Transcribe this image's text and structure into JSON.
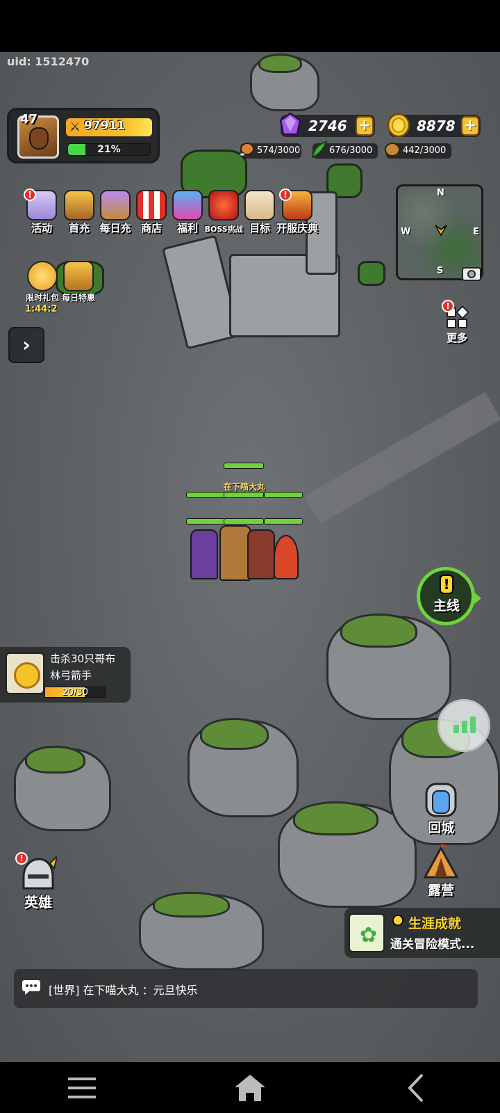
{
  "uid": "uid: 1512470",
  "player": {
    "level": "47",
    "power": "97911",
    "exp_percent": "21%",
    "exp_fraction": 0.21
  },
  "currency": {
    "gems": "2746",
    "gold": "8878"
  },
  "resources": [
    {
      "icon": "meat-icon",
      "value": "574/3000"
    },
    {
      "icon": "herb-icon",
      "value": "676/3000"
    },
    {
      "icon": "seed-icon",
      "value": "442/3000"
    }
  ],
  "activities": [
    {
      "label": "活动",
      "icon": "gift-chest-icon",
      "badge": true
    },
    {
      "label": "首充",
      "icon": "king-icon",
      "badge": false
    },
    {
      "label": "每日充",
      "icon": "treasure-cart-icon",
      "badge": false
    },
    {
      "label": "商店",
      "icon": "shop-icon",
      "badge": false
    },
    {
      "label": "福利",
      "icon": "gift-box-icon",
      "badge": false
    },
    {
      "label": "BOSS挑战",
      "icon": "demon-icon",
      "badge": false
    },
    {
      "label": "目标",
      "icon": "scroll-icon",
      "badge": false
    },
    {
      "label": "开服庆典",
      "icon": "celebration-icon",
      "badge": true
    }
  ],
  "activities_row2": [
    {
      "label": "限时礼包",
      "icon": "stopwatch-icon"
    },
    {
      "label": "每日特惠",
      "icon": "scale-icon"
    }
  ],
  "timer": "1:44:2",
  "minimap": {
    "n": "N",
    "e": "E",
    "s": "S",
    "w": "W"
  },
  "more_label": "更多",
  "hero_group": {
    "name": "在下喵大丸"
  },
  "main_quest": {
    "mark": "!",
    "label": "主线"
  },
  "task": {
    "line1": "击杀30只哥布",
    "line2": "林弓箭手",
    "progress": "20/30",
    "progress_fraction": 0.6667
  },
  "side_buttons": {
    "return_city": "回城",
    "camp": "露营"
  },
  "achievement": {
    "title": "生涯成就",
    "subtitle": "通关冒险模式..."
  },
  "hero_button": {
    "label": "英雄"
  },
  "chat": {
    "text": "[世界] 在下喵大丸 ：元旦快乐"
  },
  "colors": {
    "accent_green": "#6fd43a",
    "gold": "#f5c22a",
    "gem_purple": "#9b4de0",
    "badge_red": "#e0312a"
  }
}
